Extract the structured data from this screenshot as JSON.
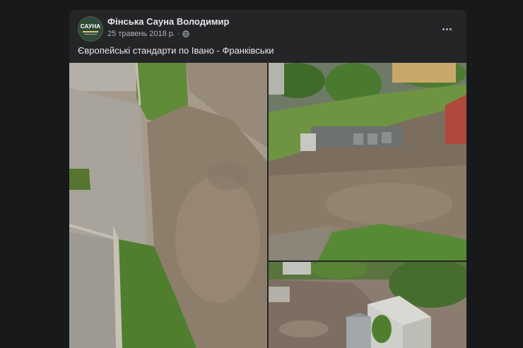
{
  "post": {
    "author": "Фінська Сауна Володимир",
    "date": "25 травень 2018 р.",
    "separator": "·",
    "text": "Європейські стандарти по Івано - Франківськи",
    "avatar_text": "САУНА",
    "globe_icon": "globe-icon",
    "more_icon": "more-options-icon"
  },
  "colors": {
    "background": "#18191a",
    "card": "#242526",
    "primary_text": "#e4e6eb",
    "secondary_text": "#b0b3b8"
  },
  "photos": [
    {
      "name": "flooded-path-photo"
    },
    {
      "name": "flooded-yard-photo"
    },
    {
      "name": "garage-yard-photo"
    }
  ]
}
